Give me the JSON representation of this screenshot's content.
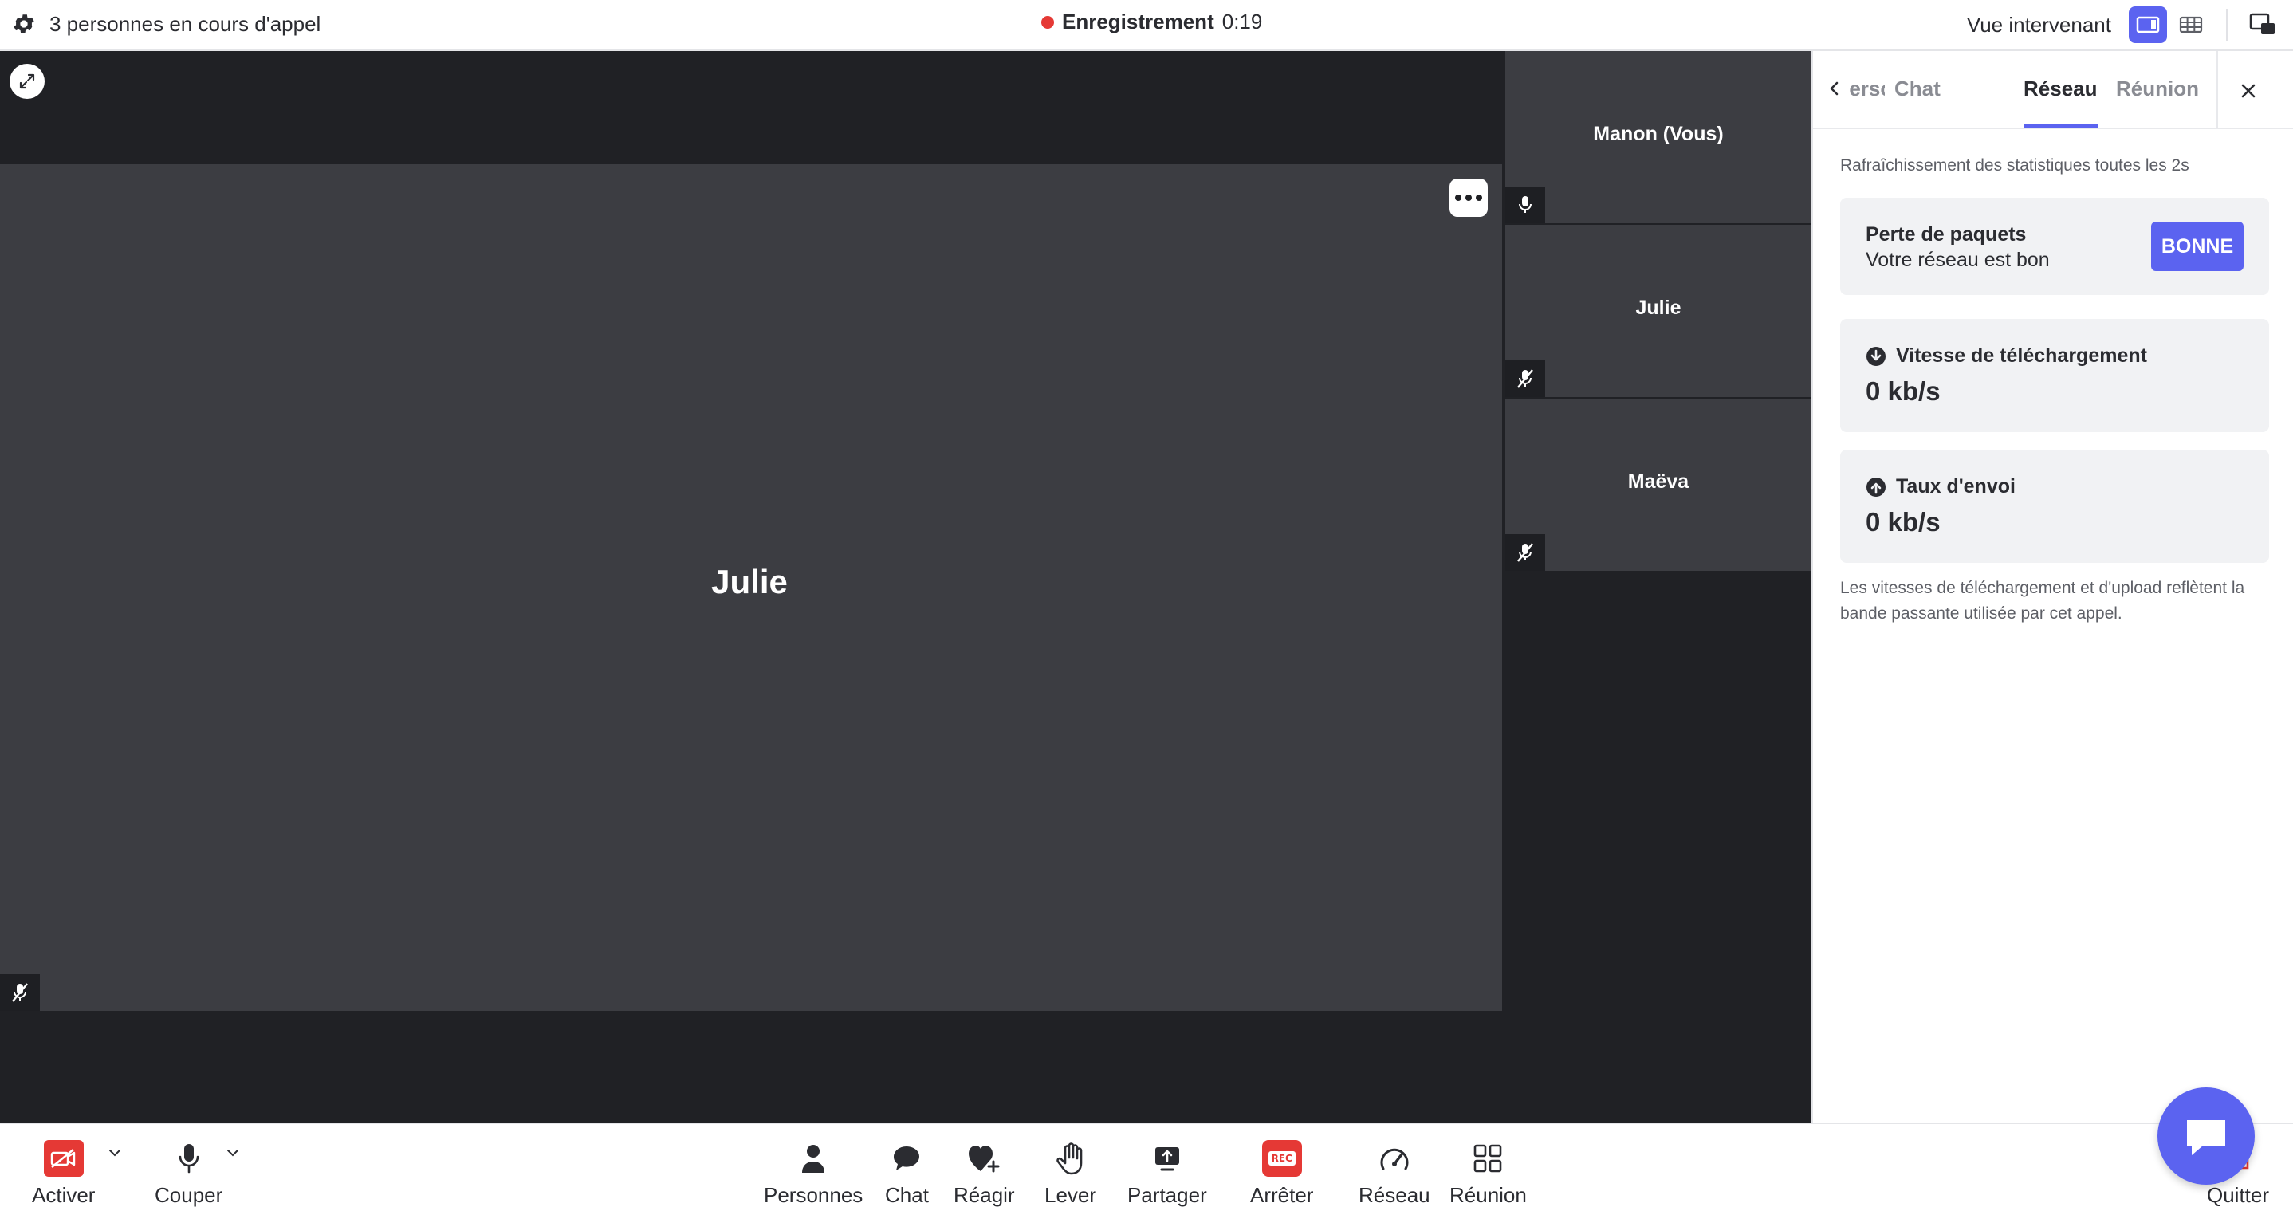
{
  "topbar": {
    "participants_text": "3 personnes en cours d'appel",
    "recording_label": "Enregistrement",
    "recording_time": "0:19",
    "view_label": "Vue intervenant"
  },
  "stage": {
    "main_tile_name": "Julie",
    "side_tiles": [
      {
        "name": "Manon (Vous)",
        "mic": "on"
      },
      {
        "name": "Julie",
        "mic": "muted"
      },
      {
        "name": "Maëva",
        "mic": "muted"
      }
    ]
  },
  "panel": {
    "tabs": [
      "Personnes",
      "Chat",
      "Réseau",
      "Réunion"
    ],
    "active_tab": "Réseau",
    "refresh_note": "Rafraîchissement des statistiques toutes les 2s",
    "packet_loss": {
      "title": "Perte de paquets",
      "subtitle": "Votre réseau est bon",
      "badge": "BONNE"
    },
    "download": {
      "title": "Vitesse de téléchargement",
      "value": "0 kb/s"
    },
    "upload": {
      "title": "Taux d'envoi",
      "value": "0 kb/s"
    },
    "footnote": "Les vitesses de téléchargement et d'upload reflètent la bande passante utilisée par cet appel."
  },
  "toolbar": {
    "camera_label": "Activer",
    "mic_label": "Couper",
    "people_label": "Personnes",
    "chat_label": "Chat",
    "react_label": "Réagir",
    "raise_label": "Lever",
    "share_label": "Partager",
    "stop_rec_label": "Arrêter",
    "rec_badge": "REC",
    "network_label": "Réseau",
    "meeting_label": "Réunion",
    "quit_label": "Quitter"
  },
  "colors": {
    "accent": "#5b63f0",
    "danger": "#e53935",
    "stage_bg": "#202125",
    "tile_bg": "#3c3d42"
  }
}
